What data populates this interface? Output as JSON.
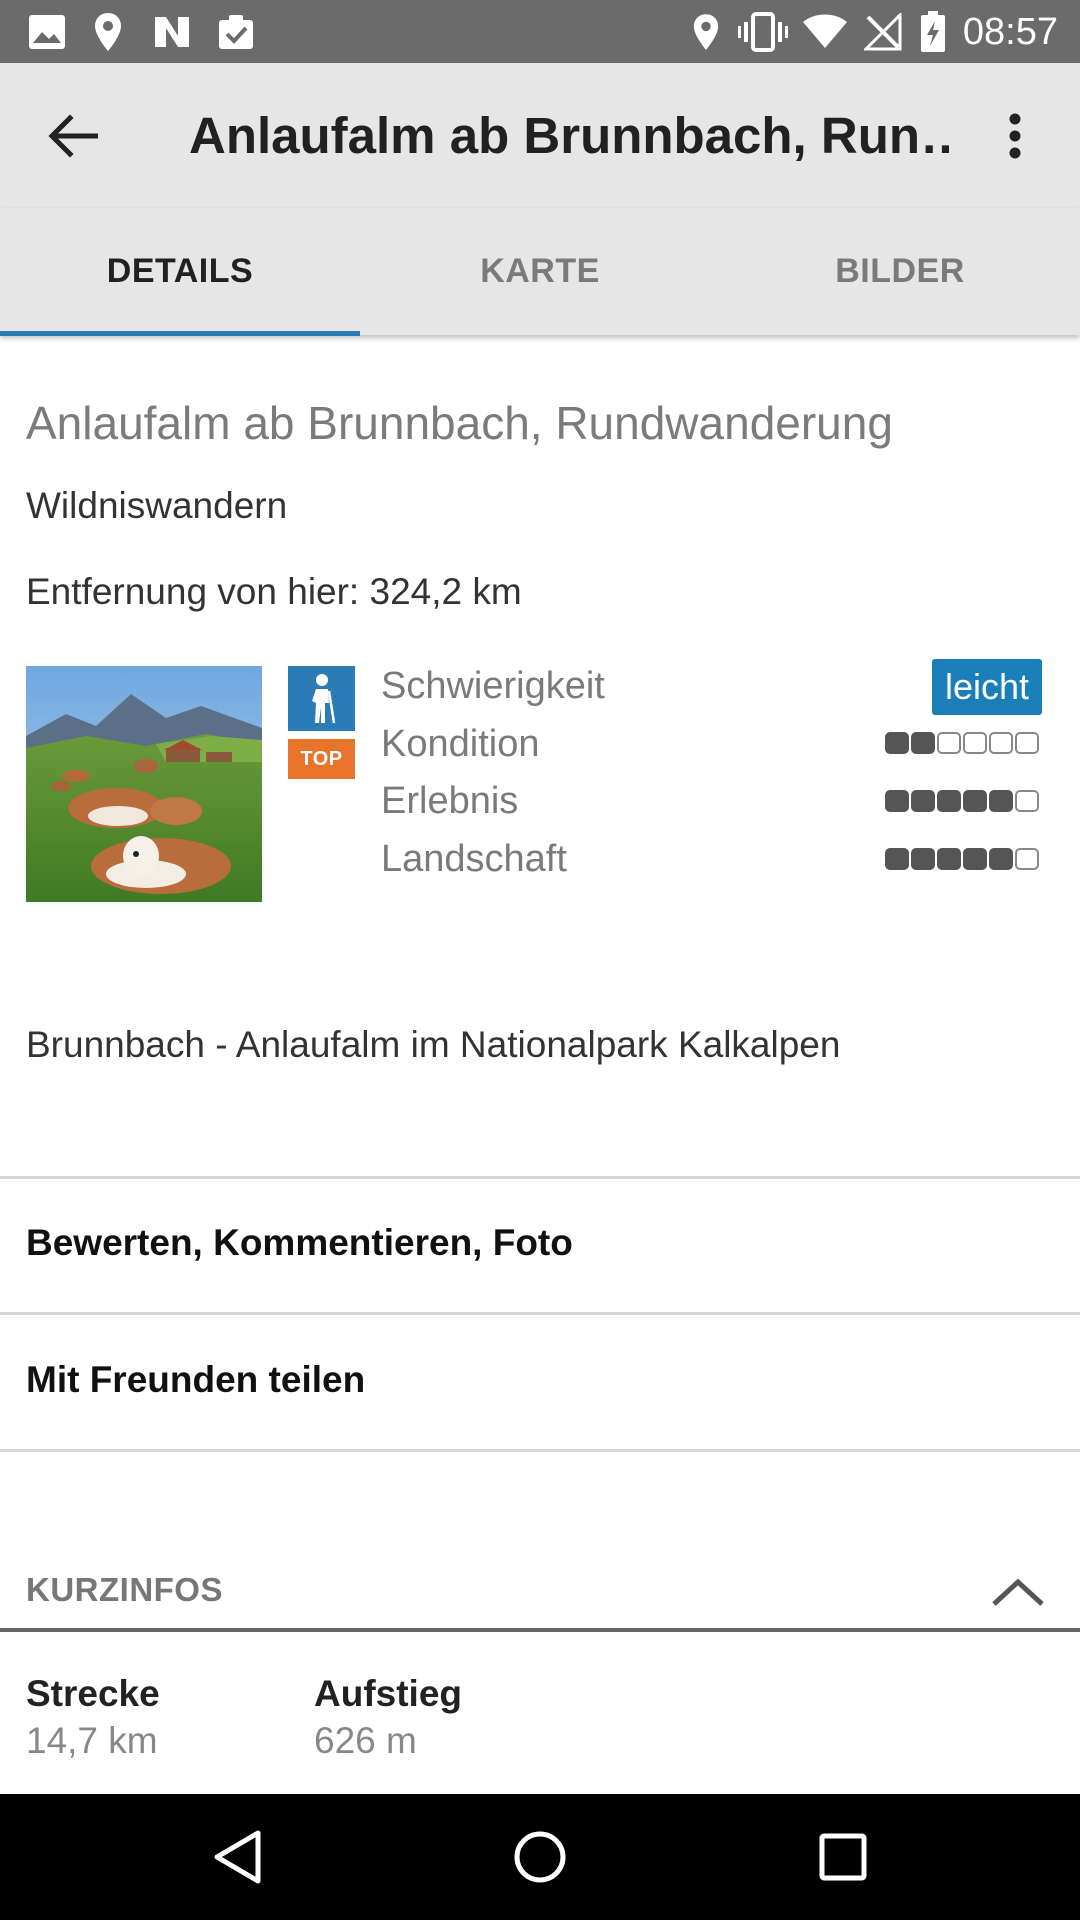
{
  "status_bar": {
    "time": "08:57",
    "left_icons": [
      "image-icon",
      "location-pin-icon",
      "nfc-icon",
      "clipboard-check-icon"
    ],
    "right_icons": [
      "location-pin-icon",
      "vibrate-icon",
      "wifi-icon",
      "no-signal-icon",
      "battery-charging-icon"
    ]
  },
  "app_bar": {
    "title": "Anlaufalm ab Brunnbach, Run…"
  },
  "tabs": [
    {
      "label": "DETAILS",
      "active": true
    },
    {
      "label": "KARTE",
      "active": false
    },
    {
      "label": "BILDER",
      "active": false
    }
  ],
  "tour": {
    "title": "Anlaufalm ab Brunnbach, Rundwanderung",
    "category": "Wildniswandern",
    "distance": "Entfernung von hier: 324,2 km",
    "badge_top": "TOP",
    "ratings": [
      {
        "label": "Schwierigkeit",
        "value_text": "leicht"
      },
      {
        "label": "Kondition",
        "filled": 2,
        "max": 6
      },
      {
        "label": "Erlebnis",
        "filled": 5,
        "max": 6
      },
      {
        "label": "Landschaft",
        "filled": 5,
        "max": 6
      }
    ],
    "description": "Brunnbach - Anlaufalm im Nationalpark Kalkalpen"
  },
  "actions": {
    "rate": "Bewerten, Kommentieren, Foto",
    "share": "Mit Freunden teilen"
  },
  "kurzinfos": {
    "title": "KURZINFOS",
    "items": [
      {
        "label": "Strecke",
        "value": "14,7 km"
      },
      {
        "label": "Aufstieg",
        "value": "626 m"
      }
    ]
  },
  "colors": {
    "accent": "#2a7bb6",
    "badge_blue": "#1a7fb8",
    "badge_orange": "#e8742b",
    "app_bar_bg": "#e6e6e6",
    "status_bar_bg": "#6b6b6b"
  }
}
